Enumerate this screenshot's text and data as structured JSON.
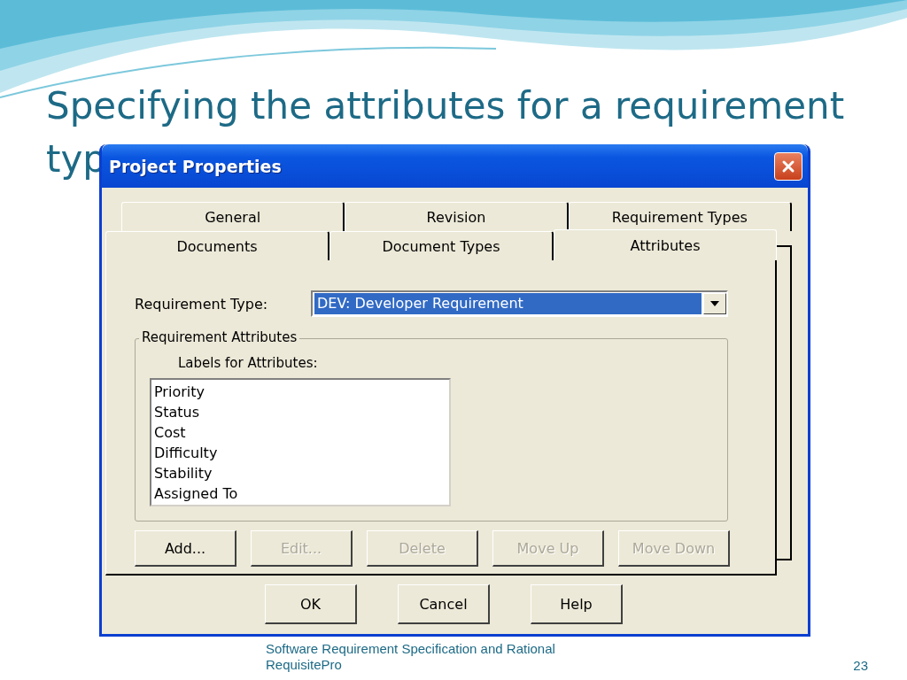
{
  "slide": {
    "title": "Specifying the attributes for a requirement",
    "title_continued": "typ",
    "footer": "Software Requirement Specification and Rational RequisitePro",
    "page_number": "23"
  },
  "dialog": {
    "title": "Project Properties",
    "tab_rows": [
      [
        {
          "label": "General",
          "selected": false
        },
        {
          "label": "Revision",
          "selected": false
        },
        {
          "label": "Requirement Types",
          "selected": false
        }
      ],
      [
        {
          "label": "Documents",
          "selected": false
        },
        {
          "label": "Document Types",
          "selected": false
        },
        {
          "label": "Attributes",
          "selected": true
        }
      ]
    ],
    "requirement_type": {
      "label": "Requirement Type:",
      "value": "DEV: Developer Requirement",
      "highlighted": true
    },
    "group": {
      "title": "Requirement Attributes",
      "list_label": "Labels for Attributes:",
      "items": [
        "Priority",
        "Status",
        "Cost",
        "Difficulty",
        "Stability",
        "Assigned To"
      ]
    },
    "actions": [
      {
        "label": "Add...",
        "disabled": false
      },
      {
        "label": "Edit...",
        "disabled": true
      },
      {
        "label": "Delete",
        "disabled": true
      },
      {
        "label": "Move Up",
        "disabled": true
      },
      {
        "label": "Move Down",
        "disabled": true
      }
    ],
    "buttons": [
      {
        "label": "OK"
      },
      {
        "label": "Cancel"
      },
      {
        "label": "Help"
      }
    ]
  }
}
